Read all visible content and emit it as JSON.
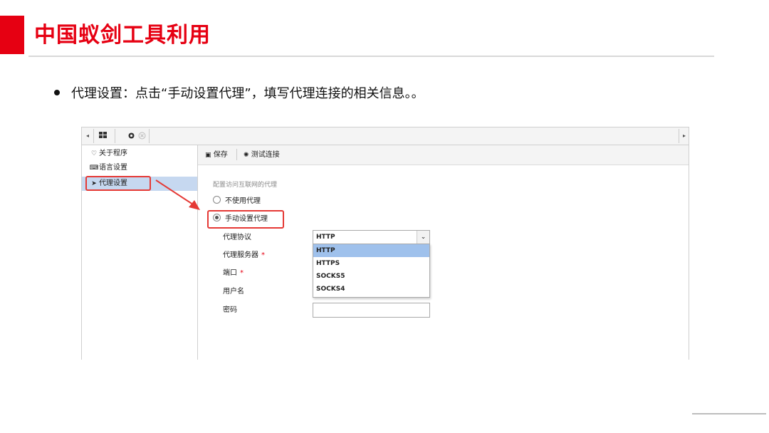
{
  "slide": {
    "title": "中国蚁剑工具利用",
    "bullet": "代理设置：点击“手动设置代理”，填写代理连接的相关信息。。",
    "accent_color": "#e60012"
  },
  "app": {
    "tabbar": {
      "left_arrow": "◂",
      "right_arrow": "▸",
      "grid_icon": "grid-icon",
      "settings_icon": "gear-icon",
      "close_icon": "close-icon"
    },
    "sidebar": {
      "items": [
        {
          "icon": "heart-icon",
          "glyph": "♡",
          "label": "关于程序"
        },
        {
          "icon": "language-icon",
          "glyph": "⌨",
          "label": "语言设置"
        },
        {
          "icon": "paper-plane-icon",
          "glyph": "➤",
          "label": "代理设置",
          "active": true
        }
      ]
    },
    "toolbar": {
      "save_label": "保存",
      "save_icon": "save-icon",
      "test_label": "测试连接",
      "test_icon": "spinner-icon"
    },
    "proxy_panel": {
      "section_label": "配置访问互联网的代理",
      "radio_no_proxy": "不使用代理",
      "radio_manual": "手动设置代理",
      "selected_radio": "手动设置代理",
      "fields": {
        "protocol_label": "代理协议",
        "server_label": "代理服务器",
        "port_label": "端口",
        "username_label": "用户名",
        "password_label": "密码",
        "required_mark": "*"
      },
      "protocol_select": {
        "value": "HTTP",
        "options": [
          "HTTP",
          "HTTPS",
          "SOCKS5",
          "SOCKS4"
        ],
        "highlighted": "HTTP"
      }
    }
  },
  "annotations": {
    "highlight_color": "#e53935"
  }
}
